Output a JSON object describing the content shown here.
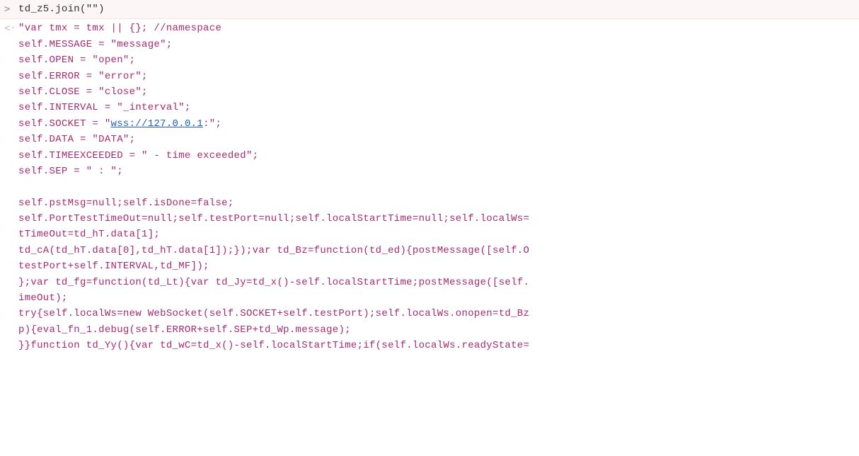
{
  "input": {
    "prompt_marker": ">",
    "code": "td_z5.join(\"\")"
  },
  "output": {
    "return_marker": "<·",
    "lines": [
      {
        "text": "\"var tmx = tmx || {}; //namespace"
      },
      {
        "text": "self.MESSAGE = \"message\";"
      },
      {
        "text": "self.OPEN = \"open\";"
      },
      {
        "text": "self.ERROR = \"error\";"
      },
      {
        "text": "self.CLOSE = \"close\";"
      },
      {
        "text": "self.INTERVAL = \"_interval\";"
      },
      {
        "prefix": "self.SOCKET = \"",
        "link": "wss://127.0.0.1",
        "suffix": ":\";"
      },
      {
        "text": "self.DATA = \"DATA\";"
      },
      {
        "text": "self.TIMEEXCEEDED = \" - time exceeded\";"
      },
      {
        "text": "self.SEP = \" : \";"
      },
      {
        "text": ""
      },
      {
        "text": "self.pstMsg=null;self.isDone=false;"
      },
      {
        "text": "self.PortTestTimeOut=null;self.testPort=null;self.localStartTime=null;self.localWs="
      },
      {
        "text": "tTimeOut=td_hT.data[1];"
      },
      {
        "text": "td_cA(td_hT.data[0],td_hT.data[1]);});var td_Bz=function(td_ed){postMessage([self.O"
      },
      {
        "text": "testPort+self.INTERVAL,td_MF]);"
      },
      {
        "text": "};var td_fg=function(td_Lt){var td_Jy=td_x()-self.localStartTime;postMessage([self."
      },
      {
        "text": "imeOut);"
      },
      {
        "text": "try{self.localWs=new WebSocket(self.SOCKET+self.testPort);self.localWs.onopen=td_Bz"
      },
      {
        "text": "p){eval_fn_1.debug(self.ERROR+self.SEP+td_Wp.message);"
      },
      {
        "text": "}}function td_Yy(){var td_wC=td_x()-self.localStartTime;if(self.localWs.readyState="
      }
    ]
  }
}
